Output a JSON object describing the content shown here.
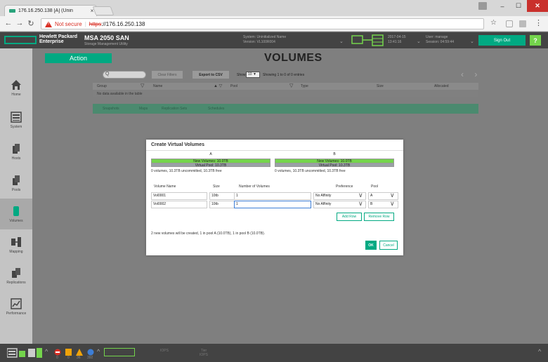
{
  "browser": {
    "tab_title": "176.16.250.138 [A] (Unin",
    "tab_close": "×",
    "not_secure": "Not secure",
    "separator": "|",
    "url_scheme": "https",
    "url_host": "://176.16.250.138",
    "minimize": "–",
    "maximize": "☐",
    "close": "✕"
  },
  "header": {
    "brand_line1": "Hewlett Packard",
    "brand_line2": "Enterprise",
    "product": "MSA 2050 SAN",
    "subproduct": "Storage Management Utility",
    "system_line1": "System: Uninitialized Name",
    "system_line2": "Version: VL100R004",
    "date_line1": "2017-04-15",
    "date_line2": "13:41:16",
    "user_line1": "User: manage",
    "user_line2": "Session: 04:59:44",
    "sign_out": "Sign Out",
    "help": "?"
  },
  "sidebar": {
    "items": [
      {
        "label": "Home"
      },
      {
        "label": "System"
      },
      {
        "label": "Hosts"
      },
      {
        "label": "Pools"
      },
      {
        "label": "Volumes"
      },
      {
        "label": "Mapping"
      },
      {
        "label": "Replications"
      },
      {
        "label": "Performance"
      }
    ]
  },
  "main": {
    "action": "Action",
    "title": "VOLUMES",
    "search_placeholder": "Q",
    "clear_filters": "Clear Filters",
    "export_csv": "Export to CSV",
    "show": "Show",
    "show_value": "10 ▼",
    "entries": "Showing 1 to 0 of 0 entries",
    "pager": "‹ ›",
    "columns": [
      "Group",
      "Name",
      "Pool",
      "Type",
      "Size",
      "Allocated"
    ],
    "no_data": "No data available in the table",
    "detail_tabs": [
      "Snapshots",
      "Maps",
      "Replication Sets",
      "Schedules"
    ]
  },
  "modal": {
    "title": "Create Virtual Volumes",
    "pools": [
      {
        "name": "A",
        "new_volumes": "New Volumes: 10.0TB",
        "virtual_pool": "Virtual Pool: 10.3TB",
        "footer": "0 volumes, 10.3TB uncommitted, 10.3TB free"
      },
      {
        "name": "B",
        "new_volumes": "New Volumes: 10.0TB",
        "virtual_pool": "Virtual Pool: 10.3TB",
        "footer": "0 volumes, 10.3TB uncommitted, 10.3TB free"
      }
    ],
    "columns": {
      "name": "Volume Name",
      "size": "Size",
      "count": "Number of Volumes",
      "pref": "Preference",
      "pool": "Pool"
    },
    "rows": [
      {
        "name": "Vol0001",
        "size": "10tb",
        "count": "1",
        "pref": "No Affinity",
        "pool": "A"
      },
      {
        "name": "Vol0002",
        "size": "10tb",
        "count": "1",
        "pref": "No Affinity",
        "pool": "B"
      }
    ],
    "add_row": "Add Row",
    "remove_row": "Remove Row",
    "summary": "2 new volumes will be created, 1 in pool A (10.0TB), 1 in pool B (10.0TB).",
    "ok": "OK",
    "cancel": "Cancel"
  },
  "footer": {
    "counts": [
      "0",
      "0",
      "36",
      "392"
    ],
    "iops_label": "IOPS",
    "tier_label": "Tier",
    "tier_iops": "IOPS"
  },
  "colors": {
    "accent": "#01a982",
    "green": "#74d44c",
    "danger": "#d93025"
  }
}
